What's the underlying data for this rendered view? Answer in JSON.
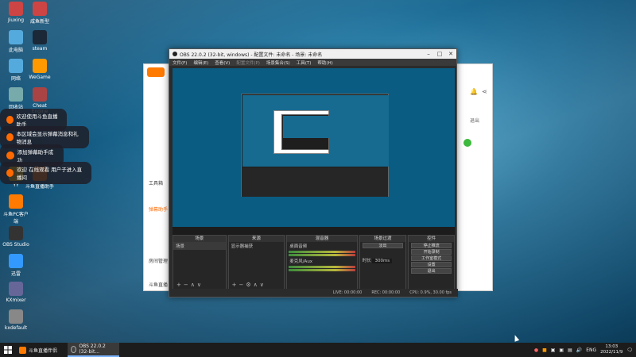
{
  "desktop": {
    "icons": [
      {
        "label": "Jiuxing",
        "icon": "app-icon"
      },
      {
        "label": "咸鱼新型",
        "icon": "app-icon"
      },
      {
        "label": "此电脑",
        "icon": "computer-icon"
      },
      {
        "label": "steam",
        "icon": "steam-icon"
      },
      {
        "label": "网络",
        "icon": "network-icon"
      },
      {
        "label": "WeGame",
        "icon": "wegame-icon"
      },
      {
        "label": "回收站",
        "icon": "recycle-bin-icon"
      },
      {
        "label": "Cheat Engine",
        "icon": "cheat-engine-icon"
      },
      {
        "label": "YY",
        "icon": "yy-icon"
      },
      {
        "label": "斗鱼直播助手",
        "icon": "douyu-icon"
      },
      {
        "label": "斗鱼PC客户端",
        "icon": "douyu-icon"
      },
      {
        "label": "OBS Studio",
        "icon": "obs-icon"
      },
      {
        "label": "迅雷",
        "icon": "xunlei-icon"
      },
      {
        "label": "KXmixer",
        "icon": "mixer-icon"
      },
      {
        "label": "kxdefault",
        "icon": "kx-icon"
      }
    ]
  },
  "toasts": [
    {
      "text": "欢迎使用斗鱼直播助手"
    },
    {
      "text": "本区域会显示弹幕消息和礼物消息"
    },
    {
      "text": "添加弹幕助手成功"
    },
    {
      "text": "欢迎 在线观看 用户子进入直播间"
    }
  ],
  "douyu_window": {
    "sidebar": [
      "工具箱",
      "弹幕助手",
      "房间管理",
      "斗鱼直播"
    ],
    "exit_label": "退出"
  },
  "obs": {
    "title": "OBS 22.0.2 (32-bit, windows) - 配置文件: 未命名 - 场景: 未命名",
    "menu": [
      "文件(F)",
      "编辑(E)",
      "查看(V)",
      "配置文件(P)",
      "场景集合(S)",
      "工具(T)",
      "帮助(H)"
    ],
    "docks": {
      "scenes": {
        "header": "场景",
        "items": [
          "场景"
        ]
      },
      "sources": {
        "header": "来源",
        "items": [
          "显示器捕获"
        ]
      },
      "mixer": {
        "header": "混音器",
        "channels": [
          "桌面音频",
          "麦克风/Aux"
        ]
      },
      "transitions": {
        "header": "场景过渡",
        "type": "淡出",
        "duration_label": "时长",
        "duration_value": "300ms"
      },
      "controls": {
        "header": "控件",
        "buttons": [
          "停止推流",
          "开始录制",
          "工作室模式",
          "设置",
          "退出"
        ]
      }
    },
    "status": {
      "live": "LIVE: 00:00:00",
      "rec": "REC: 00:00:00",
      "cpu": "CPU: 0.9%, 30.00 fps"
    }
  },
  "taskbar": {
    "tasks": [
      {
        "label": "斗鱼直播伴侣",
        "icon": "douyu-icon"
      },
      {
        "label": "OBS 22.0.2 (32-bit...",
        "icon": "obs-icon"
      }
    ],
    "lang": "ENG",
    "time": "13:03",
    "date": "2022/11/9"
  }
}
